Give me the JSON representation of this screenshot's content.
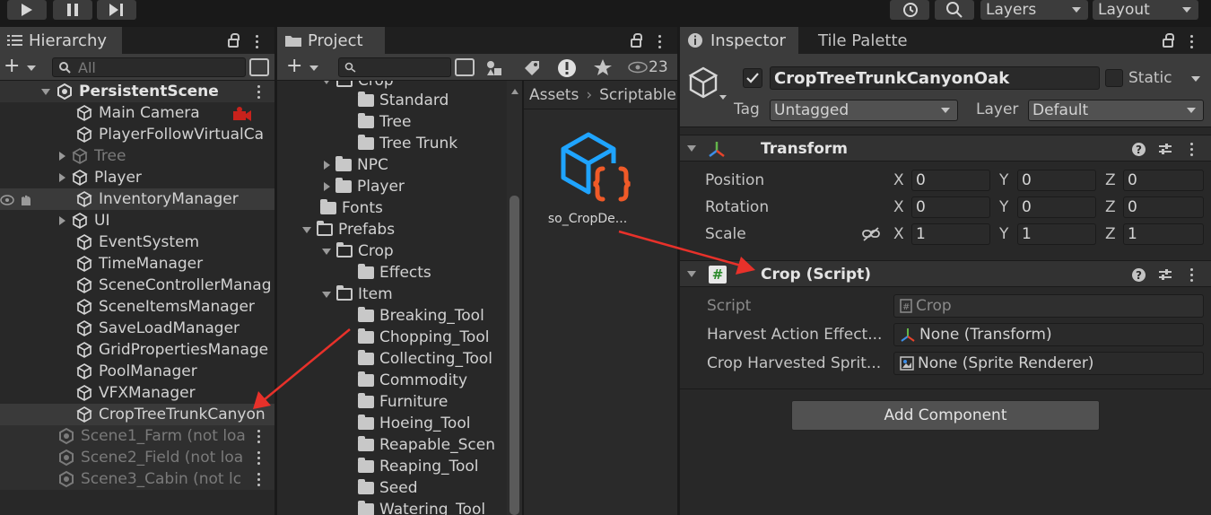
{
  "toolbar": {
    "layers_label": "Layers",
    "layout_label": "Layout"
  },
  "hierarchy": {
    "tab_label": "Hierarchy",
    "search_placeholder": "All",
    "scene_name": "PersistentScene",
    "items": [
      {
        "label": "Main Camera"
      },
      {
        "label": "PlayerFollowVirtualCa"
      },
      {
        "label": "Tree"
      },
      {
        "label": "Player"
      },
      {
        "label": "InventoryManager"
      },
      {
        "label": "UI"
      },
      {
        "label": "EventSystem"
      },
      {
        "label": "TimeManager"
      },
      {
        "label": "SceneControllerManag"
      },
      {
        "label": "SceneItemsManager"
      },
      {
        "label": "SaveLoadManager"
      },
      {
        "label": "GridPropertiesManage"
      },
      {
        "label": "PoolManager"
      },
      {
        "label": "VFXManager"
      },
      {
        "label": "CropTreeTrunkCanyon"
      }
    ],
    "unloaded_scenes": [
      {
        "label": "Scene1_Farm (not loa"
      },
      {
        "label": "Scene2_Field (not loa"
      },
      {
        "label": "Scene3_Cabin (not lc"
      }
    ]
  },
  "project": {
    "tab_label": "Project",
    "badge_count": "23",
    "tree": [
      {
        "label": "Crop"
      },
      {
        "label": "Standard"
      },
      {
        "label": "Tree"
      },
      {
        "label": "Tree Trunk"
      },
      {
        "label": "NPC"
      },
      {
        "label": "Player"
      },
      {
        "label": "Fonts"
      },
      {
        "label": "Prefabs"
      },
      {
        "label": "Crop"
      },
      {
        "label": "Effects"
      },
      {
        "label": "Item"
      },
      {
        "label": "Breaking_Tool"
      },
      {
        "label": "Chopping_Tool"
      },
      {
        "label": "Collecting_Tool"
      },
      {
        "label": "Commodity"
      },
      {
        "label": "Furniture"
      },
      {
        "label": "Hoeing_Tool"
      },
      {
        "label": "Reapable_Scen"
      },
      {
        "label": "Reaping_Tool"
      },
      {
        "label": "Seed"
      },
      {
        "label": "Watering_Tool"
      }
    ],
    "breadcrumb": [
      "Assets",
      "Scriptable"
    ],
    "asset_label": "so_CropDe..."
  },
  "inspector": {
    "tab_label": "Inspector",
    "tab2_label": "Tile Palette",
    "object_name": "CropTreeTrunkCanyonOak",
    "static_label": "Static",
    "tag_label": "Tag",
    "tag_value": "Untagged",
    "layer_label": "Layer",
    "layer_value": "Default",
    "transform": {
      "title": "Transform",
      "rows": [
        {
          "label": "Position",
          "x": "0",
          "y": "0",
          "z": "0"
        },
        {
          "label": "Rotation",
          "x": "0",
          "y": "0",
          "z": "0"
        },
        {
          "label": "Scale",
          "x": "1",
          "y": "1",
          "z": "1"
        }
      ]
    },
    "crop_script": {
      "title": "Crop (Script)",
      "script_label": "Script",
      "script_value": "Crop",
      "harvest_label": "Harvest Action Effect...",
      "harvest_value": "None (Transform)",
      "sprite_label": "Crop Harvested Sprit...",
      "sprite_value": "None (Sprite Renderer)"
    },
    "add_component": "Add Component"
  },
  "axes": {
    "x": "X",
    "y": "Y",
    "z": "Z"
  },
  "colors": {
    "arrow_red": "#e8312a",
    "accent_cube": "#1fa4ff",
    "braces": "#f05a28"
  }
}
